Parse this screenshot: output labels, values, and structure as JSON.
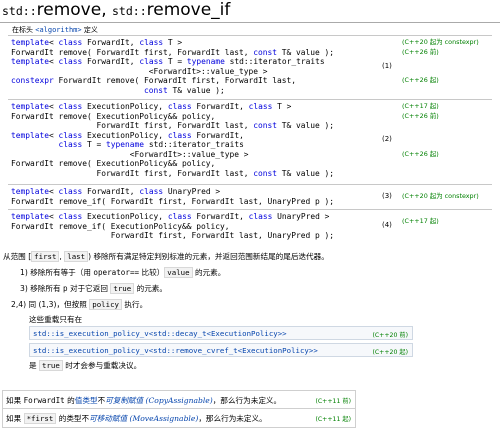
{
  "title": {
    "ns1": "std::",
    "name1": "remove",
    "sep": ", ",
    "ns2": "std::",
    "name2": "remove_if"
  },
  "header": {
    "prefix": "在标头 ",
    "name": "<algorithm>",
    "suffix": " 定义"
  },
  "decls": [
    {
      "num": "(1)",
      "lines": [
        [
          "kw:template",
          "< ",
          "kw:class",
          " ForwardIt, ",
          "kw:class",
          " T >"
        ],
        [
          "ForwardIt remove( ForwardIt first, ForwardIt last, ",
          "kw:const",
          " T& value );"
        ],
        [
          "kw:template",
          "< ",
          "kw:class",
          " ForwardIt, ",
          "kw:class",
          " T = ",
          "kw:typename",
          " std::iterator_traits"
        ],
        [
          "                             <ForwardIt>::value_type >"
        ],
        [
          "kw:constexpr",
          " ForwardIt remove( ForwardIt first, ForwardIt last,"
        ],
        [
          "                            ",
          "kw:const",
          " T& value );"
        ]
      ],
      "stds": [
        {
          "line": 0,
          "text": "(C++20 起为 constexpr)"
        },
        {
          "line": 1,
          "text": "(C++26 前)"
        },
        {
          "line": 4,
          "text": "(C++26 起)"
        }
      ]
    },
    {
      "num": "(2)",
      "lines": [
        [
          "kw:template",
          "< ",
          "kw:class",
          " ExecutionPolicy, ",
          "kw:class",
          " ForwardIt, ",
          "kw:class",
          " T >"
        ],
        [
          "ForwardIt remove( ExecutionPolicy&& policy,"
        ],
        [
          "                  ForwardIt first, ForwardIt last, ",
          "kw:const",
          " T& value );"
        ],
        [
          "kw:template",
          "< ",
          "kw:class",
          " ExecutionPolicy, ",
          "kw:class",
          " ForwardIt,"
        ],
        [
          "          ",
          "kw:class",
          " T = ",
          "kw:typename",
          " std::iterator_traits"
        ],
        [
          "                         <ForwardIt>::value_type >"
        ],
        [
          "ForwardIt remove( ExecutionPolicy&& policy,"
        ],
        [
          "                  ForwardIt first, ForwardIt last, ",
          "kw:const",
          " T& value );"
        ]
      ],
      "stds": [
        {
          "line": 0,
          "text": "(C++17 起)"
        },
        {
          "line": 1,
          "text": "(C++26 前)"
        },
        {
          "line": 5,
          "text": "(C++26 起)"
        }
      ]
    },
    {
      "num": "(3)",
      "lines": [
        [
          "kw:template",
          "< ",
          "kw:class",
          " ForwardIt, ",
          "kw:class",
          " UnaryPred >"
        ],
        [
          "ForwardIt remove_if( ForwardIt first, ForwardIt last, UnaryPred p );"
        ]
      ],
      "stds": [
        {
          "line": 0,
          "text": "(C++20 起为 constexpr)",
          "offset": 5
        }
      ]
    },
    {
      "num": "(4)",
      "lines": [
        [
          "kw:template",
          "< ",
          "kw:class",
          " ExecutionPolicy, ",
          "kw:class",
          " ForwardIt, ",
          "kw:class",
          " UnaryPred >"
        ],
        [
          "ForwardIt remove_if( ExecutionPolicy&& policy,"
        ],
        [
          "                     ForwardIt first, ForwardIt last, UnaryPred p );"
        ]
      ],
      "stds": [
        {
          "line": 0,
          "text": "(C++17 起)",
          "offset": 5
        }
      ]
    }
  ],
  "desc": {
    "intro_a": "从范围 [",
    "first": "first",
    "intro_b": ", ",
    "last": "last",
    "intro_c": ") 移除所有满足特定判别标准的元素，并返回范围新结尾的尾后迭代器。",
    "item1_a": "1) 移除所有等于（用 ",
    "item1_op": "operator==",
    "item1_b": " 比较）",
    "item1_val": "value",
    "item1_c": " 的元素。",
    "item3_a": "3) 移除所有 ",
    "item3_p": "p",
    "item3_b": " 对于它返回 ",
    "item3_true": "true",
    "item3_c": " 的元素。",
    "item24_a": "2,4) 同 (1,3)，但按照 ",
    "item24_policy": "policy",
    "item24_b": " 执行。",
    "overload": "这些重载只有在",
    "cond1": "std::is_execution_policy_v<std::decay_t<ExecutionPolicy>>",
    "cond1_std": "(C++20 前)",
    "cond2": "std::is_execution_policy_v<std::remove_cvref_t<ExecutionPolicy>>",
    "cond2_std": "(C++20 起)",
    "is_a": "是 ",
    "is_true": "true",
    "is_b": " 时才会参与重载决议。"
  },
  "notes": [
    {
      "a": "如果 ",
      "code": "ForwardIt",
      "b": " 的",
      "link": "值类型",
      "c": "不",
      "ital": "可复制赋值 (CopyAssignable)",
      "d": "，那么行为未定义。",
      "std": "(C++11 前)"
    },
    {
      "a": "如果 ",
      "code": "*first",
      "b": " 的类型不",
      "link": "",
      "c": "",
      "ital": "可移动赋值 (MoveAssignable)",
      "d": "，那么行为未定义。",
      "std": "(C++11 起)"
    }
  ]
}
